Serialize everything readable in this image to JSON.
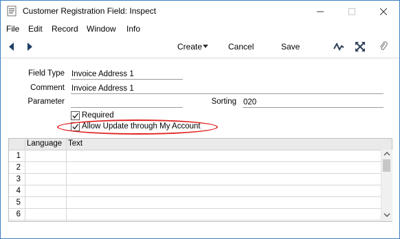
{
  "window": {
    "title": "Customer Registration Field: Inspect",
    "controls": {
      "minimize": "—",
      "maximize": "☐",
      "close": "✕"
    }
  },
  "menu": [
    "File",
    "Edit",
    "Record",
    "Window",
    "Info"
  ],
  "toolbar": {
    "create_label": "Create",
    "cancel_label": "Cancel",
    "save_label": "Save",
    "icons": [
      "prev-record-icon",
      "next-record-icon",
      "dropdown-arrow-icon",
      "sparkline-icon",
      "expand-icon",
      "paperclip-icon"
    ]
  },
  "form": {
    "field_type_label": "Field Type",
    "field_type_value": "Invoice Address 1",
    "comment_label": "Comment",
    "comment_value": "Invoice Address 1",
    "parameter_label": "Parameter",
    "parameter_value": "",
    "sorting_label": "Sorting",
    "sorting_value": "020",
    "required_label": "Required",
    "required_checked": true,
    "allow_update_label": "Allow Update through My Account",
    "allow_update_checked": true,
    "highlight_color": "#e0211f"
  },
  "grid": {
    "columns": [
      "Language",
      "Text"
    ],
    "rows": [
      {
        "num": "1",
        "language": "",
        "text": ""
      },
      {
        "num": "2",
        "language": "",
        "text": ""
      },
      {
        "num": "3",
        "language": "",
        "text": ""
      },
      {
        "num": "4",
        "language": "",
        "text": ""
      },
      {
        "num": "5",
        "language": "",
        "text": ""
      },
      {
        "num": "6",
        "language": "",
        "text": ""
      }
    ]
  }
}
